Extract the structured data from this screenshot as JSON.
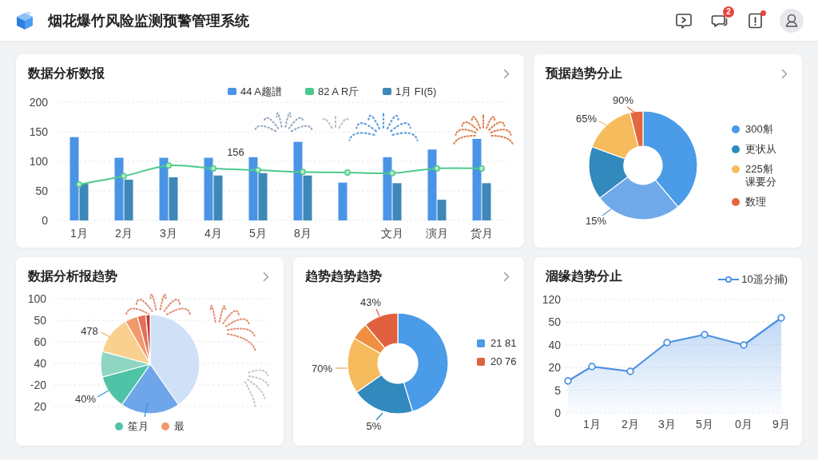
{
  "header": {
    "title": "烟花爆竹风险监测预警管理系统",
    "message_badge": "2",
    "alert_dot": true
  },
  "bar_chart_panel": {
    "title": "数据分析数报",
    "chart_data": {
      "type": "bar",
      "legend": "top",
      "grid": true,
      "categories": [
        "1月",
        "2月",
        "3月",
        "4月",
        "5月",
        "8月",
        null,
        "文月",
        "演月",
        "货月"
      ],
      "series": [
        {
          "name": "44 A趨譜",
          "type": "bar",
          "color": "#4a94e6",
          "values": [
            141,
            106,
            106,
            106,
            107,
            133,
            64,
            107,
            120,
            138
          ]
        },
        {
          "name": "82 A R斤",
          "type": "line",
          "marker": "circle",
          "color": "#4cc98e",
          "values": [
            61,
            75,
            93,
            88,
            85,
            82,
            81,
            80,
            88,
            88
          ]
        },
        {
          "name": "1月 FI(5)",
          "type": "bar",
          "color": "#3d88b8",
          "values": [
            62,
            69,
            73,
            76,
            80,
            76,
            null,
            63,
            35,
            63
          ]
        }
      ],
      "ylim": [
        0,
        200
      ],
      "yticks": [
        0,
        50,
        100,
        150,
        200
      ],
      "annotations": [
        "156"
      ]
    }
  },
  "donut_chart_panel": {
    "title": "预据趋势分止",
    "slice_labels": [
      "90%",
      "65%",
      "15%"
    ],
    "legend": [
      {
        "label": "300斛",
        "color": "#4a9be8"
      },
      {
        "label": "更状从",
        "color": "#3189bd"
      },
      {
        "label": "225斛课要分",
        "color": "#f6bb5c"
      },
      {
        "label": "数理",
        "color": "#e2673f"
      }
    ]
  },
  "pie_chart_panel": {
    "title": "数据分析报趋势",
    "axis_labels": [
      "100",
      "50",
      "60",
      "40",
      "-20",
      "20"
    ],
    "slice_labels": [
      "478",
      "40%"
    ],
    "legend": [
      {
        "label": "笙月",
        "color": "#4fc3a6"
      },
      {
        "label": "最",
        "color": "#ef9a6a"
      }
    ]
  },
  "second_donut_panel": {
    "title": "趋势趋势趋势",
    "slice_labels": [
      "43%",
      "70%",
      "5%"
    ],
    "legend": [
      {
        "label": "21 81",
        "color": "#4a9be8"
      },
      {
        "label": "20 76",
        "color": "#e0603e"
      }
    ]
  },
  "line_chart_panel": {
    "title": "涸缘趋势分止",
    "legend": {
      "label": "10遥分捕)",
      "color": "#4a90e2"
    },
    "y_axis_labels": [
      "120",
      "50",
      "40",
      "20",
      "5",
      "0"
    ],
    "x_axis_labels": [
      "1月",
      "2月",
      "3月",
      "5月",
      "0月",
      "9月"
    ]
  }
}
